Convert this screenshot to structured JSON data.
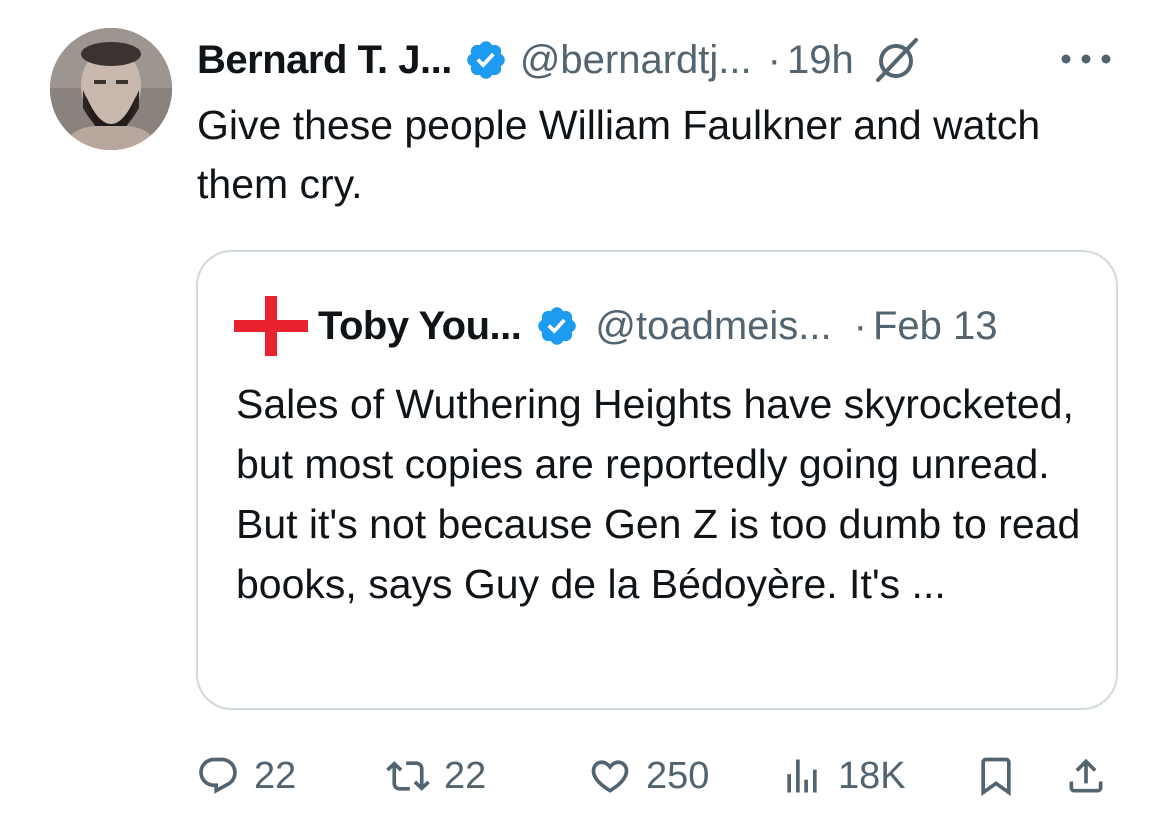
{
  "tweet": {
    "author_name": "Bernard T. J...",
    "handle": "@bernardtj...",
    "separator": "·",
    "time": "19h",
    "text": "Give these people William Faulkner and watch them cry."
  },
  "quote": {
    "author_name": "Toby You...",
    "handle": "@toadmeis...",
    "separator": "·",
    "date": "Feb 13",
    "text": "Sales of Wuthering Heights have skyrocketed, but most copies are reportedly going unread. But it's not because Gen Z is too dumb to read books, says Guy de la Bédoyère. It's ..."
  },
  "actions": {
    "replies": "22",
    "reposts": "22",
    "likes": "250",
    "views": "18K"
  },
  "icons": {
    "verified": "verified-badge-icon",
    "grok": "grok-icon",
    "more": "more-icon",
    "reply": "reply-icon",
    "repost": "repost-icon",
    "like": "heart-icon",
    "views": "views-icon",
    "bookmark": "bookmark-icon",
    "share": "share-icon"
  },
  "colors": {
    "verified_blue": "#1d9bf0",
    "secondary_text": "#536471",
    "border": "#cfd9de",
    "quote_avatar_red": "#e8232f"
  }
}
